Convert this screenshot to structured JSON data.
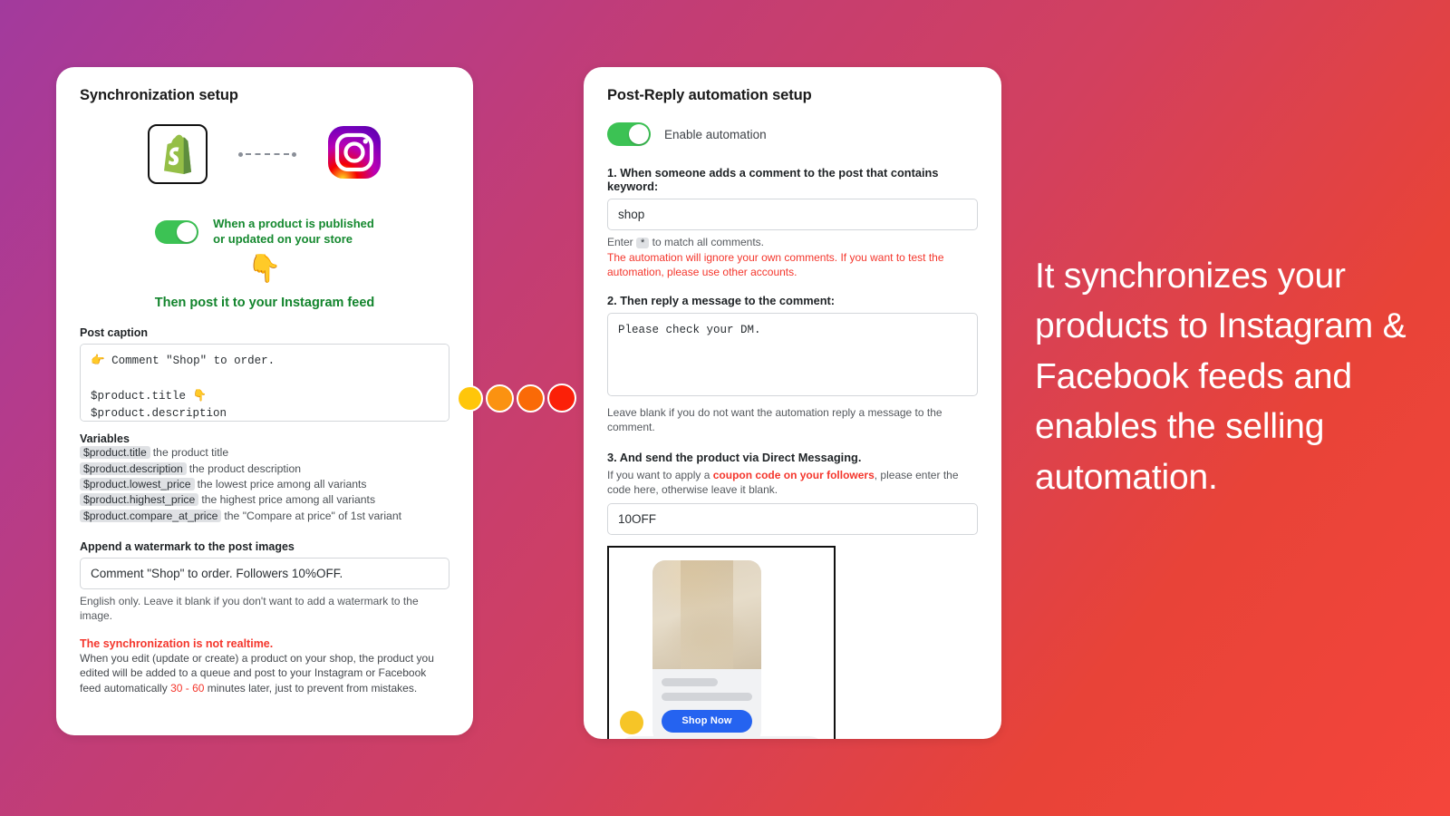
{
  "background": {
    "gradient_from": "#a23a9d",
    "gradient_mid": "#c33d74",
    "gradient_to": "#f4453b"
  },
  "left_card": {
    "title": "Synchronization setup",
    "icons": {
      "shopify": "shopify-logo-icon",
      "link": "dashed-connector-icon",
      "instagram": "instagram-logo-icon"
    },
    "sync_toggle": {
      "state": "on",
      "label_line1": "When a product is published",
      "label_line2": "or updated on your store"
    },
    "arrow_emoji": "👇",
    "then_post": "Then post it to your Instagram feed",
    "post_caption": {
      "label": "Post caption",
      "value": "👉 Comment \"Shop\" to order.\n\n$product.title 👇\n$product.description"
    },
    "variables": {
      "title": "Variables",
      "items": [
        {
          "token": "$product.title",
          "desc": "the product title"
        },
        {
          "token": "$product.description",
          "desc": "the product description"
        },
        {
          "token": "$product.lowest_price",
          "desc": "the lowest price among all variants"
        },
        {
          "token": "$product.highest_price",
          "desc": "the highest price among all variants"
        },
        {
          "token": "$product.compare_at_price",
          "desc": "the \"Compare at price\" of 1st variant"
        }
      ]
    },
    "watermark": {
      "label": "Append a watermark to the post images",
      "value": "Comment \"Shop\" to order. Followers 10%OFF.",
      "helper": "English only. Leave it blank if you don't want to add a watermark to the image."
    },
    "realtime_notice": {
      "heading": "The synchronization is not realtime.",
      "body_before": "When you edit (update or create) a product on your shop, the product you edited will be added to a queue and post to your Instagram or Facebook feed automatically ",
      "highlight": "30 - 60",
      "body_after": " minutes later, just to prevent from mistakes."
    }
  },
  "connector_dots": {
    "colors": [
      "#ffc60a",
      "#fb9211",
      "#fa6a07",
      "#fb2008"
    ]
  },
  "right_card": {
    "title": "Post-Reply automation setup",
    "enable_toggle": {
      "state": "on",
      "label": "Enable automation"
    },
    "step1": {
      "label": "1. When someone adds a comment to the post that contains keyword:",
      "value": "shop",
      "helper_before": "Enter ",
      "helper_pill": "*",
      "helper_after": " to match all comments.",
      "warning": "The automation will ignore your own comments. If you want to test the automation, please use other accounts."
    },
    "step2": {
      "label": "2. Then reply a message to the comment:",
      "value": "Please check your DM.",
      "helper": "Leave blank if you do not want the automation reply a message to the comment."
    },
    "step3": {
      "label": "3. And send the product  via Direct Messaging.",
      "helper_before": "If you want to apply a ",
      "helper_link": "coupon code on your followers",
      "helper_after": ", please enter the code here, otherwise leave it blank.",
      "value": "10OFF"
    },
    "phone_preview": {
      "shop_now_label": "Shop Now",
      "avatar": "sender-avatar",
      "composer_icons": [
        "camera-icon",
        "microphone-icon",
        "image-icon",
        "sticker-icon"
      ]
    }
  },
  "promo": {
    "text": "It synchronizes your products to Instagram & Facebook feeds and enables the selling automation."
  }
}
